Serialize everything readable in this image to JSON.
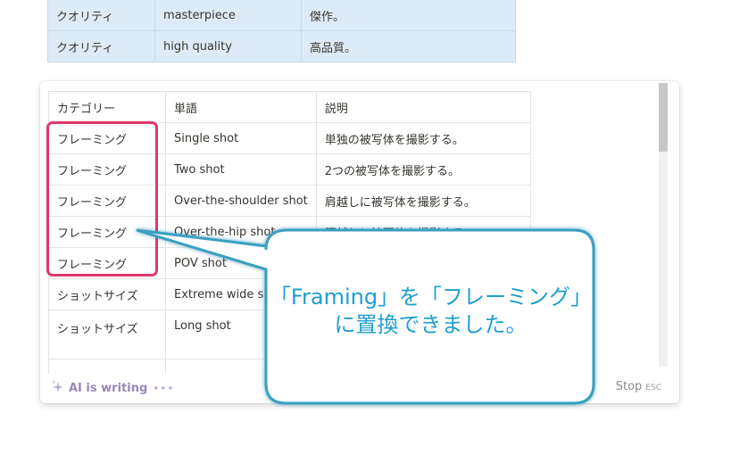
{
  "top_table": {
    "rows": [
      [
        "クオリティ",
        "masterpiece",
        "傑作。"
      ],
      [
        "クオリティ",
        "high quality",
        "高品質。"
      ]
    ]
  },
  "ai_table": {
    "headers": [
      "カテゴリー",
      "単語",
      "説明"
    ],
    "rows": [
      [
        "フレーミング",
        "Single shot",
        "単独の被写体を撮影する。"
      ],
      [
        "フレーミング",
        "Two shot",
        "2つの被写体を撮影する。"
      ],
      [
        "フレーミング",
        "Over-the-shoulder shot",
        "肩越しに被写体を撮影する。"
      ],
      [
        "フレーミング",
        "Over-the-hip shot",
        "腰越しに被写体を撮影する。"
      ],
      [
        "フレーミング",
        "POV shot",
        ""
      ],
      [
        "ショットサイズ",
        "Extreme wide shot",
        ""
      ],
      [
        "ショットサイズ",
        "Long shot",
        ""
      ]
    ]
  },
  "footer": {
    "status": "AI is writing",
    "stop_label": "Stop",
    "stop_shortcut": "ESC",
    "icon": "sparkle-icon"
  },
  "callout": {
    "line1": "「Framing」を「フレーミング」",
    "line2": "に置換できました。",
    "border_color": "#3aa0c0",
    "text_color": "#1e9fd0"
  },
  "highlight_color": "#e0386a"
}
